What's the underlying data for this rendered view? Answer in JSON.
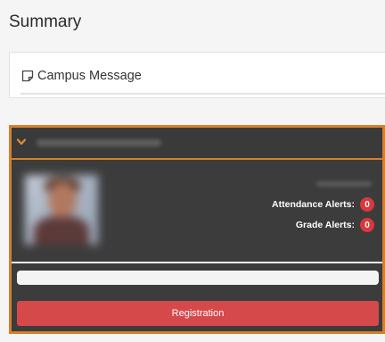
{
  "page": {
    "title": "Summary"
  },
  "campus_message": {
    "label": "Campus Message",
    "icon": "note-icon"
  },
  "student_card": {
    "attendance_alerts_label": "Attendance Alerts:",
    "attendance_alerts_count": "0",
    "grade_alerts_label": "Grade Alerts:",
    "grade_alerts_count": "0",
    "registration_label": "Registration"
  },
  "colors": {
    "accent_border": "#d77f2c",
    "card_background": "#3c3c3c",
    "badge": "#d9383d",
    "registration_button": "#d6494a"
  }
}
